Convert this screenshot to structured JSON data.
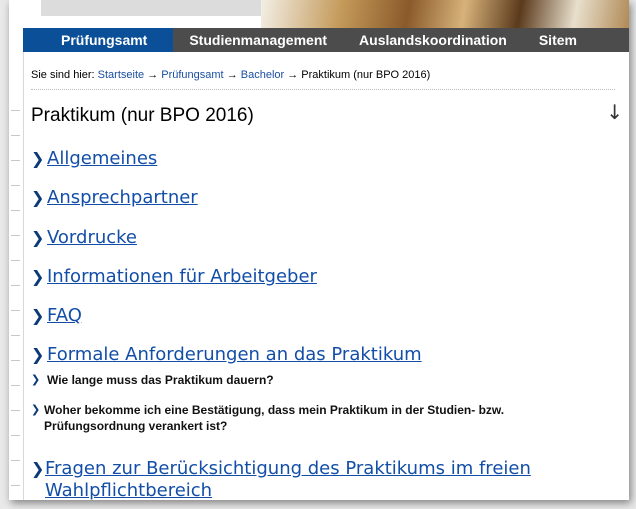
{
  "nav": {
    "items": [
      "Prüfungsamt",
      "Studienmanagement",
      "Auslandskoordination",
      "Sitem"
    ],
    "active_color": "#0a4f98",
    "bar_color": "#4c4c4c"
  },
  "breadcrumb": {
    "prefix": "Sie sind hier:",
    "links": [
      "Startseite",
      "Prüfungsamt",
      "Bachelor"
    ],
    "separator": "→",
    "current": "Praktikum (nur BPO 2016)"
  },
  "page": {
    "title": "Praktikum (nur BPO 2016)",
    "scroll_glyph": "↓"
  },
  "sections": [
    {
      "label": "Allgemeines"
    },
    {
      "label": "Ansprechpartner"
    },
    {
      "label": "Vordrucke"
    },
    {
      "label": "Informationen für Arbeitgeber"
    },
    {
      "label": "FAQ"
    },
    {
      "label": "Formale Anforderungen an das Praktikum"
    },
    {
      "label": "Fragen zur Berücksichtigung des Praktikums im freien Wahlpflichtbereich"
    }
  ],
  "subquestions": [
    {
      "label": "Wie lange muss das Praktikum dauern?"
    },
    {
      "label": "Woher bekomme ich eine Bestätigung, dass mein Praktikum in der Studien- bzw. Prüfungsordnung verankert ist?"
    }
  ],
  "icons": {
    "bullet": "chevron-right-icon",
    "scroll": "arrow-down-icon"
  }
}
